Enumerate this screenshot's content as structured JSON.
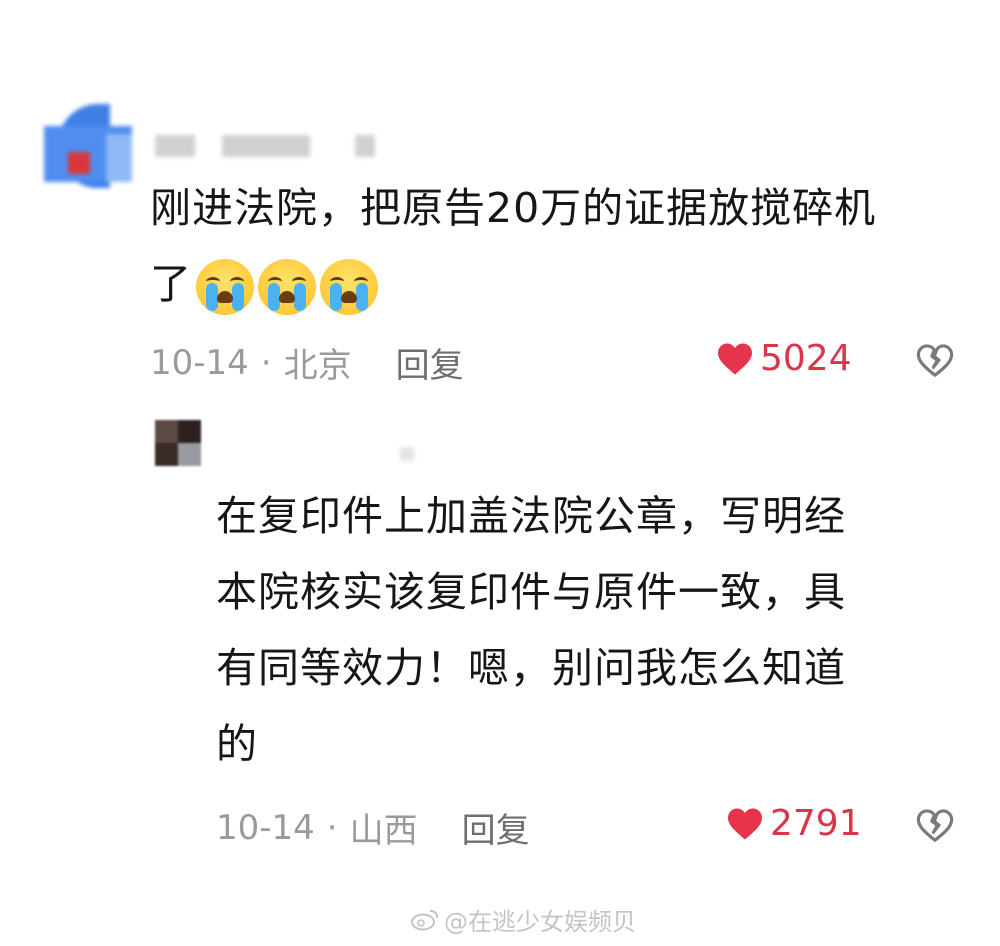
{
  "comments": [
    {
      "text": "刚进法院，把原告20万的证据放搅碎机\n了",
      "emoji": [
        "crying-face",
        "crying-face",
        "crying-face"
      ],
      "date": "10-14",
      "location": "北京",
      "reply_label": "回复",
      "likes": "5024"
    },
    {
      "text": "在复印件上加盖法院公章，写明经\n本院核实该复印件与原件一致，具\n有同等效力！嗯，别问我怎么知道\n的",
      "date": "10-14",
      "location": "山西",
      "reply_label": "回复",
      "likes": "2791"
    }
  ],
  "separator": "·",
  "watermark": "@在逃少女娱频贝",
  "colors": {
    "like_red": "#d9364a",
    "meta_gray": "#9a9a9a",
    "text": "#161616"
  }
}
